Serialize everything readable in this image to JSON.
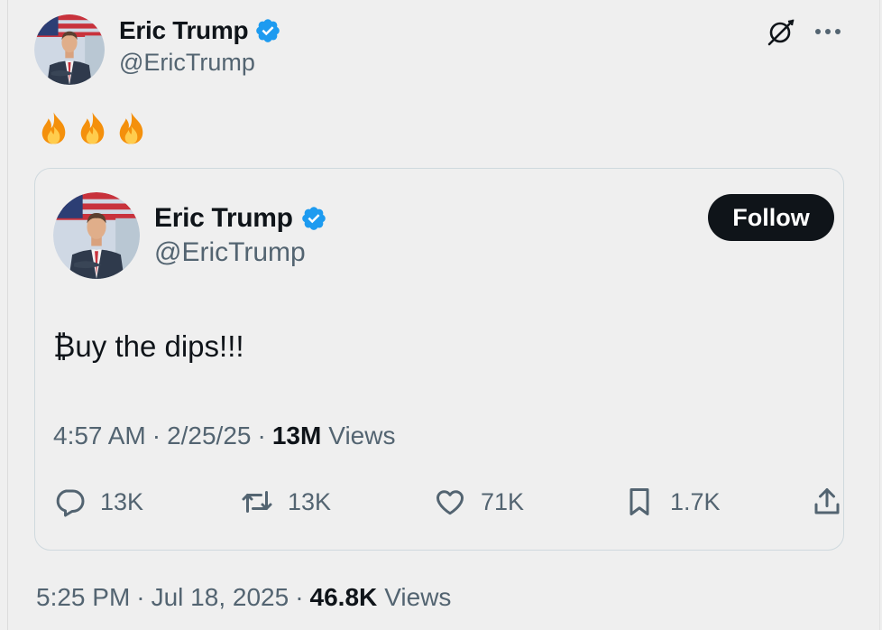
{
  "post": {
    "author": {
      "name": "Eric Trump",
      "handle": "@EricTrump",
      "avatar_icon": "profile-photo"
    },
    "text_emoji": [
      "fire",
      "fire",
      "fire"
    ],
    "timestamp": "5:25 PM",
    "date": "Jul 18, 2025",
    "views_count": "46.8K",
    "views_label": "Views",
    "separator": "·",
    "icons": [
      "grok-icon",
      "more-icon"
    ]
  },
  "quoted": {
    "author": {
      "name": "Eric Trump",
      "handle": "@EricTrump"
    },
    "follow_label": "Follow",
    "text": "₿uy the dips!!!",
    "timestamp": "4:57 AM",
    "date": "2/25/25",
    "views_count": "13M",
    "views_label": "Views",
    "separator": "·",
    "actions": {
      "replies": "13K",
      "reposts": "13K",
      "likes": "71K",
      "bookmarks": "1.7K"
    }
  },
  "colors": {
    "background": "#efefef",
    "text_primary": "#0f1419",
    "text_secondary": "#536471",
    "verified_blue": "#1d9bf0",
    "follow_button": "#0f1419",
    "card_border": "#cfd9de"
  }
}
